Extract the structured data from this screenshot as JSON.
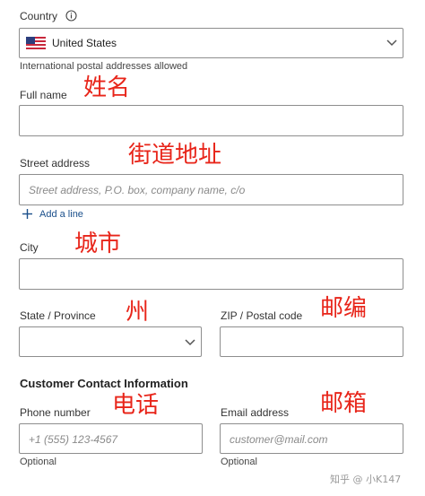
{
  "country": {
    "label": "Country",
    "selected": "United States",
    "note": "International postal addresses allowed"
  },
  "full_name": {
    "label": "Full name",
    "value": "",
    "annotation": "姓名"
  },
  "street": {
    "label": "Street address",
    "placeholder": "Street address, P.O. box, company name, c/o",
    "add_line": "Add a line",
    "annotation": "街道地址"
  },
  "city": {
    "label": "City",
    "annotation": "城市"
  },
  "state": {
    "label": "State / Province",
    "selected": "",
    "annotation": "州"
  },
  "zip": {
    "label": "ZIP / Postal code",
    "annotation": "邮编"
  },
  "contact": {
    "heading": "Customer Contact Information",
    "phone": {
      "label": "Phone number",
      "placeholder": "+1 (555) 123-4567",
      "hint": "Optional",
      "annotation": "电话"
    },
    "email": {
      "label": "Email address",
      "placeholder": "customer@mail.com",
      "hint": "Optional",
      "annotation": "邮箱"
    }
  },
  "watermark": "知乎 @ 小K147",
  "colors": {
    "annotation": "#e8251a",
    "border": "#8e8e8e",
    "accent": "#1a4f8b"
  },
  "icons": [
    "info-icon",
    "us-flag-icon",
    "chevron-down-icon",
    "plus-icon"
  ]
}
